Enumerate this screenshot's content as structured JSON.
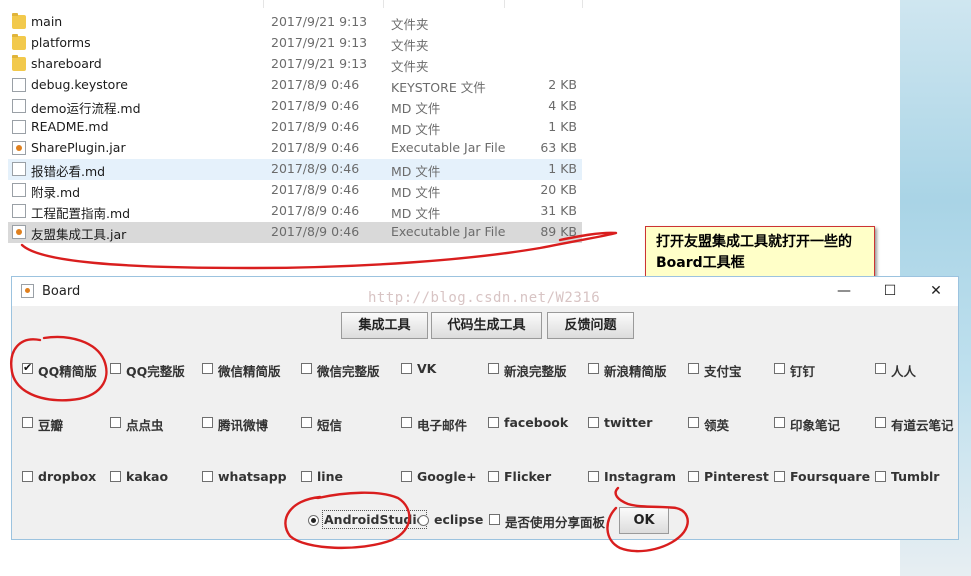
{
  "files": [
    {
      "name": "main",
      "date": "2017/9/21 9:13",
      "type": "文件夹",
      "size": "",
      "icon": "folder-icon",
      "state": ""
    },
    {
      "name": "platforms",
      "date": "2017/9/21 9:13",
      "type": "文件夹",
      "size": "",
      "icon": "folder-icon",
      "state": ""
    },
    {
      "name": "shareboard",
      "date": "2017/9/21 9:13",
      "type": "文件夹",
      "size": "",
      "icon": "folder-icon",
      "state": ""
    },
    {
      "name": "debug.keystore",
      "date": "2017/8/9 0:46",
      "type": "KEYSTORE 文件",
      "size": "2 KB",
      "icon": "file-icon",
      "state": ""
    },
    {
      "name": "demo运行流程.md",
      "date": "2017/8/9 0:46",
      "type": "MD 文件",
      "size": "4 KB",
      "icon": "file-icon",
      "state": ""
    },
    {
      "name": "README.md",
      "date": "2017/8/9 0:46",
      "type": "MD 文件",
      "size": "1 KB",
      "icon": "file-icon",
      "state": ""
    },
    {
      "name": "SharePlugin.jar",
      "date": "2017/8/9 0:46",
      "type": "Executable Jar File",
      "size": "63 KB",
      "icon": "jar-icon",
      "state": ""
    },
    {
      "name": "报错必看.md",
      "date": "2017/8/9 0:46",
      "type": "MD 文件",
      "size": "1 KB",
      "icon": "file-icon",
      "state": "hover"
    },
    {
      "name": "附录.md",
      "date": "2017/8/9 0:46",
      "type": "MD 文件",
      "size": "20 KB",
      "icon": "file-icon",
      "state": ""
    },
    {
      "name": "工程配置指南.md",
      "date": "2017/8/9 0:46",
      "type": "MD 文件",
      "size": "31 KB",
      "icon": "file-icon",
      "state": ""
    },
    {
      "name": "友盟集成工具.jar",
      "date": "2017/8/9 0:46",
      "type": "Executable Jar File",
      "size": "89 KB",
      "icon": "jar-icon",
      "state": "selected"
    }
  ],
  "callout": {
    "text": "打开友盟集成工具就打开一些的Board工具框"
  },
  "window": {
    "title": "Board",
    "watermark": "http://blog.csdn.net/W2316",
    "minimize": "—",
    "maximize": "☐",
    "close": "✕"
  },
  "toolbar": {
    "integrate": "集成工具",
    "codegen": "代码生成工具",
    "feedback": "反馈问题"
  },
  "platforms": [
    {
      "label": "QQ精简版",
      "checked": true
    },
    {
      "label": "QQ完整版",
      "checked": false
    },
    {
      "label": "微信精简版",
      "checked": false
    },
    {
      "label": "微信完整版",
      "checked": false
    },
    {
      "label": "VK",
      "checked": false
    },
    {
      "label": "新浪完整版",
      "checked": false
    },
    {
      "label": "新浪精简版",
      "checked": false
    },
    {
      "label": "支付宝",
      "checked": false
    },
    {
      "label": "钉钉",
      "checked": false
    },
    {
      "label": "人人",
      "checked": false
    },
    {
      "label": "豆瓣",
      "checked": false
    },
    {
      "label": "点点虫",
      "checked": false
    },
    {
      "label": "腾讯微博",
      "checked": false
    },
    {
      "label": "短信",
      "checked": false
    },
    {
      "label": "电子邮件",
      "checked": false
    },
    {
      "label": "facebook",
      "checked": false
    },
    {
      "label": "twitter",
      "checked": false
    },
    {
      "label": "领英",
      "checked": false
    },
    {
      "label": "印象笔记",
      "checked": false
    },
    {
      "label": "有道云笔记",
      "checked": false
    },
    {
      "label": "dropbox",
      "checked": false
    },
    {
      "label": "kakao",
      "checked": false
    },
    {
      "label": "whatsapp",
      "checked": false
    },
    {
      "label": "line",
      "checked": false
    },
    {
      "label": "Google+",
      "checked": false
    },
    {
      "label": "Flicker",
      "checked": false
    },
    {
      "label": "Instagram",
      "checked": false
    },
    {
      "label": "Pinterest",
      "checked": false
    },
    {
      "label": "Foursquare",
      "checked": false
    },
    {
      "label": "Tumblr",
      "checked": false
    }
  ],
  "ide": {
    "android_studio": "AndroidStudio",
    "eclipse": "eclipse",
    "selected": "AndroidStudio"
  },
  "share_panel": {
    "label": "是否使用分享面板",
    "checked": false
  },
  "ok_label": "OK",
  "colors": {
    "annotation": "#d91e1e",
    "callout_bg": "#ffffc8",
    "selection": "#d9d9d9",
    "hover": "#e5f1fb"
  }
}
